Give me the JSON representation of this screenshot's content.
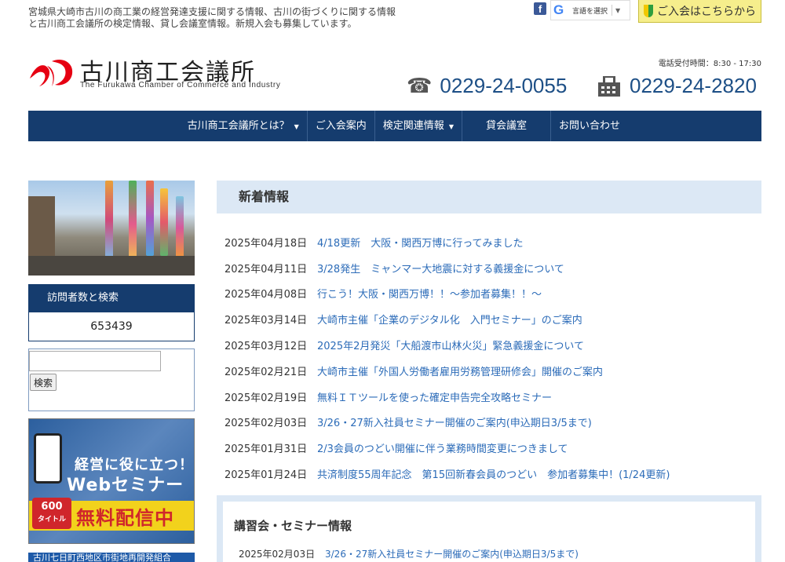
{
  "header": {
    "tagline": "宮城県大崎市古川の商工業の経営発達支援に関する情報、古川の街づくりに関する情報と古川商工会議所の検定情報、貸し会議室情報。新規入会も募集しています。",
    "translate_label": "言語を選択",
    "join_label": "ご入会はこちらから",
    "logo_name": "古川商工会議所",
    "logo_en": "The Furukawa Chamber of Commerce and Industry",
    "hours": "電話受付時間：8:30 - 17:30",
    "phone": "0229-24-0055",
    "fax": "0229-24-2820"
  },
  "nav": [
    {
      "label": "古川商工会議所とは？",
      "caret": "▼"
    },
    {
      "label": "ご入会案内",
      "caret": ""
    },
    {
      "label": "検定関連情報",
      "caret": "▼"
    },
    {
      "label": "貸会議室",
      "caret": ""
    },
    {
      "label": "お問い合わせ",
      "caret": ""
    }
  ],
  "sidebar": {
    "visitor_title": "訪問者数と検索",
    "visitor_count": "653439",
    "search_button": "検索",
    "search_value": "",
    "banner_line1": "経営に役に立つ！",
    "banner_line2": "Webセミナー",
    "banner_badge": "600",
    "banner_badge_sub": "タイトル",
    "banner_line3": "無料配信中",
    "bottom_banner": "古川七日町西地区市街地再開発組合"
  },
  "news": {
    "title": "新着情報",
    "items": [
      {
        "date": "2025年04月18日",
        "title": "4/18更新　大阪・関西万博に行ってみました"
      },
      {
        "date": "2025年04月11日",
        "title": "3/28発生　ミャンマー大地震に対する義援金について"
      },
      {
        "date": "2025年04月08日",
        "title": "行こう！大阪・関西万博！！～参加者募集！！～"
      },
      {
        "date": "2025年03月14日",
        "title": "大崎市主催「企業のデジタル化　入門セミナー」のご案内"
      },
      {
        "date": "2025年03月12日",
        "title": "2025年2月発災「大船渡市山林火災」緊急義援金について"
      },
      {
        "date": "2025年02月21日",
        "title": "大崎市主催「外国人労働者雇用労務管理研修会」開催のご案内"
      },
      {
        "date": "2025年02月19日",
        "title": "無料ＩＴツールを使った確定申告完全攻略セミナー"
      },
      {
        "date": "2025年02月03日",
        "title": "3/26・27新入社員セミナー開催のご案内(申込期日3/5まで)"
      },
      {
        "date": "2025年01月31日",
        "title": "2/3会員のつどい開催に伴う業務時間変更につきまして"
      },
      {
        "date": "2025年01月24日",
        "title": "共済制度55周年記念　第15回新春会員のつどい　参加者募集中！(1/24更新)"
      }
    ]
  },
  "seminar": {
    "title": "講習会・セミナー情報",
    "items": [
      {
        "date": "2025年02月03日",
        "title": "3/26・27新入社員セミナー開催のご案内(申込期日3/5まで)"
      }
    ]
  },
  "icons": {
    "facebook": "facebook-icon",
    "google": "google-icon",
    "phone": "telephone-icon",
    "fax": "fax-icon"
  },
  "colors": {
    "nav_bg": "#153c6e",
    "link": "#2b6bb8",
    "phone_text": "#1d4f86",
    "logo_red": "#e60012",
    "join_bg": "#f6ee8c",
    "section_bg": "#dce8f5"
  }
}
